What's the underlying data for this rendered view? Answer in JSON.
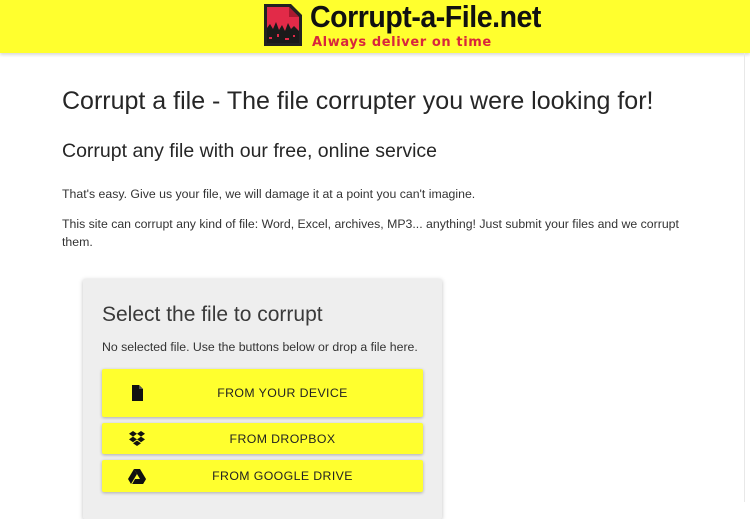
{
  "header": {
    "logo_title": "Corrupt-a-File.net",
    "logo_tagline": "Always deliver on time",
    "background_color": "#ffff2e",
    "tagline_color": "#d8263c"
  },
  "main": {
    "heading": "Corrupt a file - The file corrupter you were looking for!",
    "subheading": "Corrupt any file with our free, online service",
    "paragraph_1": "That's easy. Give us your file, we will damage it at a point you can't imagine.",
    "paragraph_2": "This site can corrupt any kind of file: Word, Excel, archives, MP3... anything! Just submit your files and we corrupt them."
  },
  "upload_card": {
    "title": "Select the file to corrupt",
    "status": "No selected file. Use the buttons below or drop a file here.",
    "buttons": [
      {
        "label": "FROM YOUR DEVICE",
        "icon": "file-icon"
      },
      {
        "label": "FROM DROPBOX",
        "icon": "dropbox-icon"
      },
      {
        "label": "FROM GOOGLE DRIVE",
        "icon": "google-drive-icon"
      }
    ],
    "button_color": "#ffff2e"
  }
}
